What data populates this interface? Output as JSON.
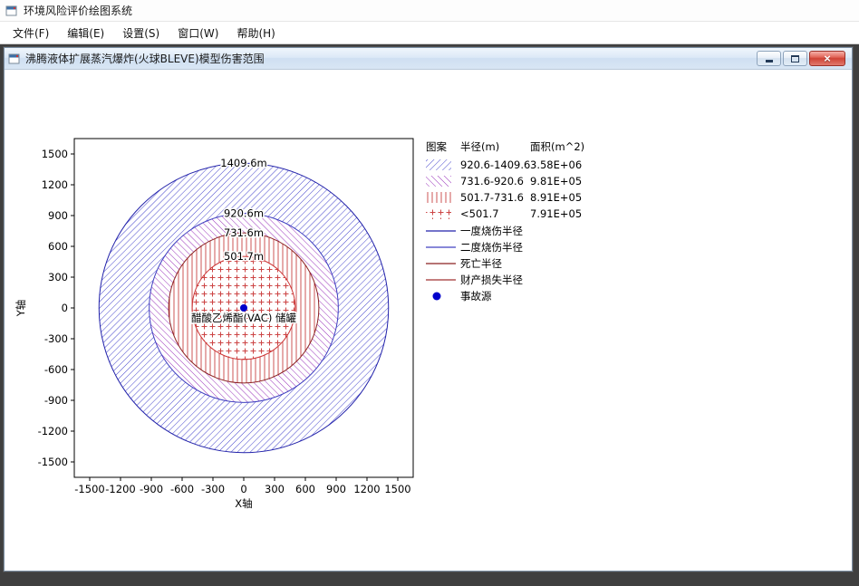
{
  "app": {
    "title": "环境风险评价绘图系统",
    "menu": [
      {
        "label": "文件(F)"
      },
      {
        "label": "编辑(E)"
      },
      {
        "label": "设置(S)"
      },
      {
        "label": "窗口(W)"
      },
      {
        "label": "帮助(H)"
      }
    ]
  },
  "child_window": {
    "title": "沸腾液体扩展蒸汽爆炸(火球BLEVE)模型伤害范围"
  },
  "icons": {
    "close": "×"
  },
  "legend": {
    "headers": [
      "图案",
      "半径(m)",
      "面积(m^2)"
    ],
    "pattern_rows": [
      {
        "hatch": "diag-blue",
        "range": "920.6-1409.6",
        "area": "3.58E+06"
      },
      {
        "hatch": "diag-purple",
        "range": "731.6-920.6",
        "area": "9.81E+05"
      },
      {
        "hatch": "vert-red",
        "range": "501.7-731.6",
        "area": "8.91E+05"
      },
      {
        "hatch": "cross-red",
        "range": "<501.7",
        "area": "7.91E+05"
      }
    ],
    "line_rows": [
      {
        "color": "#2222aa",
        "label": "一度烧伤半径"
      },
      {
        "color": "#4040c0",
        "label": "二度烧伤半径"
      },
      {
        "color": "#8b2222",
        "label": "死亡半径"
      },
      {
        "color": "#a03030",
        "label": "财产损失半径"
      }
    ],
    "marker_row": {
      "color": "#0000cc",
      "label": "事故源"
    }
  },
  "chart_data": {
    "type": "concentric-rings",
    "xlabel": "X轴",
    "ylabel": "Y轴",
    "xlim": [
      -1650,
      1650
    ],
    "ylim": [
      -1650,
      1650
    ],
    "ticks": [
      -1500,
      -1200,
      -900,
      -600,
      -300,
      0,
      300,
      600,
      900,
      1200,
      1500
    ],
    "center_marker": {
      "x": 0,
      "y": 0,
      "label": "醋酸乙烯酯(VAC) 储罐",
      "color": "#0000cc"
    },
    "rings": [
      {
        "radius_m": 1409.6,
        "label": "1409.6m",
        "stroke": "#2222aa",
        "hatch": "diag-blue"
      },
      {
        "radius_m": 920.6,
        "label": "920.6m",
        "stroke": "#4040c0",
        "hatch": "diag-purple"
      },
      {
        "radius_m": 731.6,
        "label": "731.6m",
        "stroke": "#8b2222",
        "hatch": "vert-red"
      },
      {
        "radius_m": 501.7,
        "label": "501.7m",
        "stroke": "#cc3333",
        "hatch": "cross-red"
      }
    ],
    "hatch_colors": {
      "diag-blue": "#4444cc",
      "diag-purple": "#9a33bb",
      "vert-red": "#cc5555",
      "cross-red": "#cc4444"
    }
  }
}
